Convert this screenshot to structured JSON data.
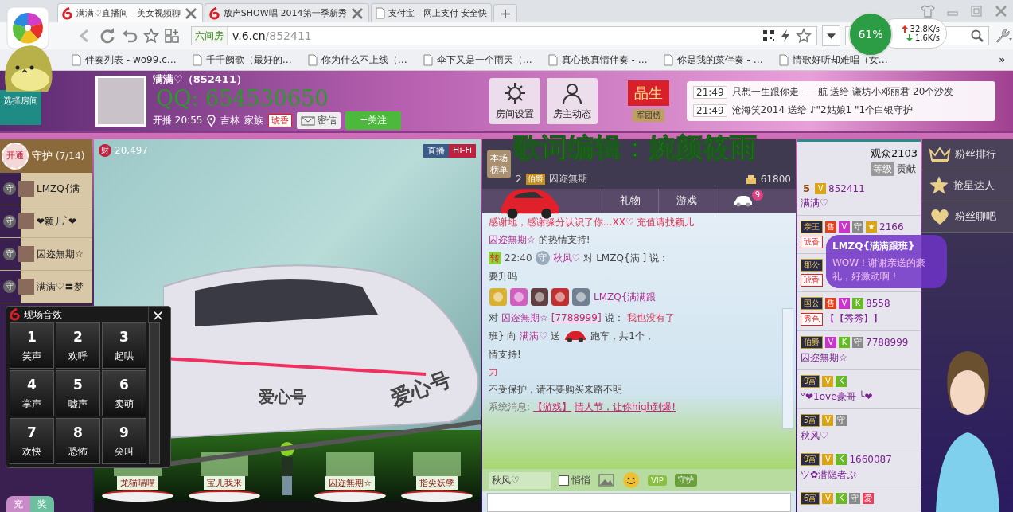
{
  "browser": {
    "tabs": [
      {
        "title": "满满♡直播间 - 美女视频聊",
        "selected": true
      },
      {
        "title": "放声SHOW唱-2014第一季新秀",
        "selected": false
      },
      {
        "title": "支付宝 - 网上支付 安全快",
        "selected": false
      }
    ],
    "new_tab": "+",
    "address": {
      "site_label": "六间房",
      "host": "v.6.cn",
      "path": "/852411"
    },
    "speed": {
      "percent": "61%",
      "up": "32.8K/s",
      "down": "1.6K/s"
    },
    "bookmarks": [
      "伴奏列表 - wo99.c…",
      "千千阙歌（最好的…",
      "你为什么不上线（…",
      "伞下又是一个雨天（…",
      "真心换真情伴奏 - …",
      "你是我的菜伴奏 - …",
      "情歌好听却难唱（女…"
    ],
    "bookmarks_more": "»"
  },
  "overlay": {
    "qq": "QQ: 654530650",
    "credit": "歌词编辑：婉颜筱雨"
  },
  "header": {
    "select_room": "选择房间",
    "host_name": "满满♡（852411）",
    "start": "开播 20:55",
    "city": "吉林",
    "family_label": "家族",
    "family_badge": "琥香",
    "message_button": "密信",
    "follow_button": "+关注",
    "actions": [
      "房间设置",
      "房主动态"
    ],
    "flag": "晶生",
    "legion": "军团榜",
    "notices": [
      {
        "time": "21:49",
        "text": "只想一生跟你走——航 送给 谦坊小邓丽君 20个沙发"
      },
      {
        "time": "21:49",
        "text": "沧海笑2014 送给 ♪\"2姑娘1 \"1个白银守护"
      }
    ]
  },
  "guards": {
    "open": "开通",
    "title": "守护",
    "count": "(7/14)",
    "members": [
      {
        "mark": "守",
        "name": "LMZQ{满"
      },
      {
        "mark": "守",
        "name": "❤颖儿`❤"
      },
      {
        "mark": "守",
        "name": "囚迩無期☆"
      },
      {
        "mark": "守",
        "name": "满满♡〓梦"
      }
    ],
    "recharge": "充",
    "reward": "奖"
  },
  "video": {
    "wealth_mark": "财",
    "wealth": "20,497",
    "badges": [
      "直播",
      "Hi-Fi"
    ],
    "stage": [
      "龙猫喵喵",
      "宝儿我来",
      "囚迩無期☆",
      "指尖妖孽"
    ]
  },
  "train": {
    "labels": [
      "爱心号",
      "爱心号"
    ]
  },
  "sound_panel": {
    "title": "现场音效",
    "close": "×",
    "keys": [
      {
        "num": "1",
        "label": "笑声"
      },
      {
        "num": "2",
        "label": "欢呼"
      },
      {
        "num": "3",
        "label": "起哄"
      },
      {
        "num": "4",
        "label": "掌声"
      },
      {
        "num": "5",
        "label": "嘘声"
      },
      {
        "num": "6",
        "label": "卖萌"
      },
      {
        "num": "7",
        "label": "欢快"
      },
      {
        "num": "8",
        "label": "恐怖"
      },
      {
        "num": "9",
        "label": "尖叫"
      }
    ]
  },
  "chat": {
    "rank_label": "本场榜单",
    "rank_rows": [
      {
        "rank": "2",
        "title": "伯爵",
        "name": "囚迩無期",
        "score": "61800"
      }
    ],
    "tabs": [
      {
        "label": "礼物",
        "selected": false
      },
      {
        "label": "游戏",
        "selected": false
      },
      {
        "kind": "car",
        "badge": "9",
        "selected": false
      }
    ],
    "messages": [
      {
        "parts": [
          {
            "kind": "alert",
            "text": "感谢地，感谢缘分认识了你...XX♡ 充值请找颖儿"
          }
        ]
      },
      {
        "parts": [
          {
            "kind": "name",
            "text": "囚迩無期☆"
          },
          {
            "kind": "plain",
            "text": "的热情支持!"
          }
        ]
      },
      {
        "parts": [
          {
            "kind": "tag",
            "text": "转"
          },
          {
            "kind": "time",
            "text": "22:40"
          },
          {
            "kind": "guard",
            "text": "守"
          },
          {
            "kind": "name",
            "text": "秋风♡"
          },
          {
            "kind": "plain",
            "text": "对 LMZQ{满"
          },
          {
            "kind": "plain",
            "text": "] 说："
          }
        ]
      },
      {
        "parts": [
          {
            "kind": "plain",
            "text": "要升吗"
          }
        ]
      },
      {
        "parts": [
          {
            "kind": "medals"
          },
          {
            "kind": "name",
            "text": "LMZQ{满满跟"
          }
        ]
      },
      {
        "parts": [
          {
            "kind": "plain",
            "text": "对"
          },
          {
            "kind": "name",
            "text": "囚迩無期☆"
          },
          {
            "kind": "link",
            "text": "[7788999]"
          },
          {
            "kind": "plain",
            "text": "说："
          },
          {
            "kind": "alert",
            "text": "我也没有了"
          }
        ]
      },
      {
        "parts": [
          {
            "kind": "plain",
            "text": "班} 向"
          },
          {
            "kind": "name",
            "text": "满满♡"
          },
          {
            "kind": "plain",
            "text": "送"
          },
          {
            "kind": "car"
          },
          {
            "kind": "plain",
            "text": "跑车，共1个，"
          }
        ]
      },
      {
        "parts": [
          {
            "kind": "plain",
            "text": "情支持!"
          }
        ]
      },
      {
        "parts": [
          {
            "kind": "alert",
            "text": "力"
          }
        ]
      },
      {
        "parts": [
          {
            "kind": "plain",
            "text": "不受保护，请不要购买来路不明"
          }
        ]
      },
      {
        "parts": [
          {
            "kind": "system",
            "text": "系统消息:"
          },
          {
            "kind": "link",
            "text": "【游戏】"
          },
          {
            "kind": "link",
            "text": "情人节，让你high到爆!"
          }
        ]
      }
    ],
    "sender": "秋风♡",
    "whisper": {
      "label": "悄悄",
      "checked": false
    },
    "vip": "VIP",
    "guard_button": "守护"
  },
  "audience": {
    "count": "观众2103",
    "tabs": [
      {
        "label": "等级",
        "selected": true
      },
      {
        "label": "贡献",
        "selected": false
      }
    ],
    "users": [
      {
        "level": "5",
        "badges": [
          {
            "text": "V",
            "color": "#d9a514"
          }
        ],
        "id": "852411",
        "name": "满满♡"
      },
      {
        "level": "亲王",
        "badges": [
          {
            "text": "售",
            "color": "#e0401a"
          },
          {
            "text": "V",
            "color": "#cc33cc"
          },
          {
            "text": "守",
            "color": "#8a8a8a"
          },
          {
            "text": "★",
            "color": "#d9a514"
          }
        ],
        "id": "2166",
        "tag": "琥香"
      },
      {
        "level": "郡公",
        "tag": "琥香"
      },
      {
        "level": "国公",
        "badges": [
          {
            "text": "售",
            "color": "#e0401a"
          },
          {
            "text": "V",
            "color": "#cc33cc"
          },
          {
            "text": "K",
            "color": "#66bb22"
          }
        ],
        "id": "8558",
        "tag": "秀色",
        "name": "【【秀秀】】"
      },
      {
        "level": "伯爵",
        "badges": [
          {
            "text": "V",
            "color": "#cc33cc"
          },
          {
            "text": "K",
            "color": "#66bb22"
          },
          {
            "text": "守",
            "color": "#8a8a8a"
          }
        ],
        "id": "7788999",
        "name": "囚迩無期☆"
      },
      {
        "level": "9富",
        "badges": [
          {
            "text": "V",
            "color": "#d9a514"
          },
          {
            "text": "K",
            "color": "#66bb22"
          }
        ],
        "name": "°❤1ove豪哥 ╰❤"
      },
      {
        "level": "5富",
        "badges": [
          {
            "text": "V",
            "color": "#d9a514"
          },
          {
            "text": "守",
            "color": "#8a8a8a"
          }
        ],
        "name": "秋风♡"
      },
      {
        "level": "9富",
        "badges": [
          {
            "text": "V",
            "color": "#d9a514"
          },
          {
            "text": "K",
            "color": "#66bb22"
          }
        ],
        "id": "1660087",
        "name": "ツ✿潜隐者ぷ"
      },
      {
        "level": "6富",
        "badges": [
          {
            "text": "V",
            "color": "#d9a514"
          },
          {
            "text": "K",
            "color": "#66bb22"
          },
          {
            "text": "守",
            "color": "#8a8a8a"
          },
          {
            "text": "爱",
            "color": "#e8405a"
          }
        ]
      }
    ]
  },
  "bubble": {
    "name": "LMZQ{满满跟班}",
    "text": "WOW！谢谢亲送的豪礼，好激动啊！"
  },
  "side_menu": [
    {
      "label": "粉丝排行",
      "kind": "crown"
    },
    {
      "label": "抢星达人",
      "kind": "star"
    },
    {
      "label": "粉丝聊吧",
      "kind": "heart"
    }
  ]
}
